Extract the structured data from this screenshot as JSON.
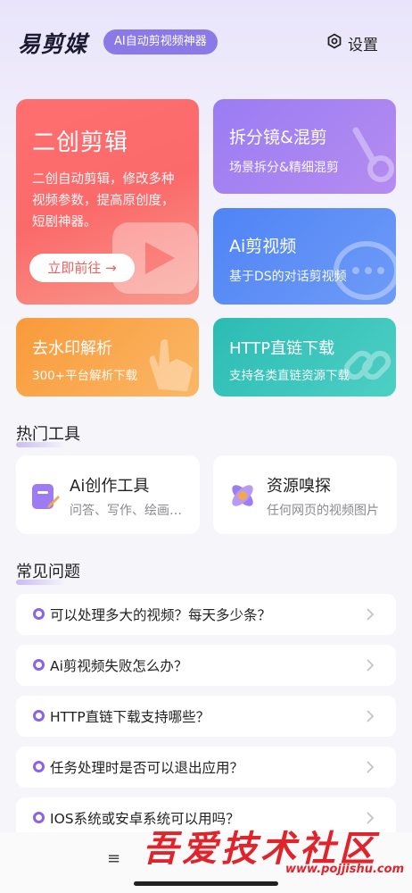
{
  "header": {
    "logo": "易剪媒",
    "slogan": "AI自动剪视频神器",
    "settings_label": "设置"
  },
  "cards": {
    "main": {
      "title": "二创剪辑",
      "desc": "二创自动剪辑，修改多种视频参数，提高原创度，短剧神器。",
      "button": "立即前往 →"
    },
    "split": {
      "title": "拆分镜&混剪",
      "desc": "场景拆分&精细混剪"
    },
    "ai_video": {
      "title": "Ai剪视频",
      "desc": "基于DS的对话剪视频"
    },
    "watermark": {
      "title": "去水印解析",
      "desc": "300+平台解析下载"
    },
    "http": {
      "title": "HTTP直链下载",
      "desc": "支持各类直链资源下载"
    }
  },
  "hot_tools": {
    "title": "热门工具",
    "items": [
      {
        "title": "Ai创作工具",
        "desc": "问答、写作、绘画…",
        "icon": "pencil-doc-icon"
      },
      {
        "title": "资源嗅探",
        "desc": "任何网页的视频图片",
        "icon": "atom-sniff-icon"
      }
    ]
  },
  "faq": {
    "title": "常见问题",
    "items": [
      {
        "q": "可以处理多大的视频？每天多少条？"
      },
      {
        "q": "Ai剪视频失败怎么办？"
      },
      {
        "q": "HTTP直链下载支持哪些？"
      },
      {
        "q": "任务处理时是否可以退出应用？"
      },
      {
        "q": "IOS系统或安卓系统可以用吗？"
      }
    ]
  },
  "bottom": {
    "menu_glyph": "≡"
  },
  "watermark": {
    "text": "吾爱技术社区",
    "url": "www.pojjishu.com"
  },
  "colors": {
    "accent": "#8a63e6",
    "main_card": "#fb6a6a",
    "split_card": "#a583f2",
    "ai_card": "#5a8cf6",
    "watermark_card": "#fa9f43",
    "http_card": "#2fbfb6"
  }
}
